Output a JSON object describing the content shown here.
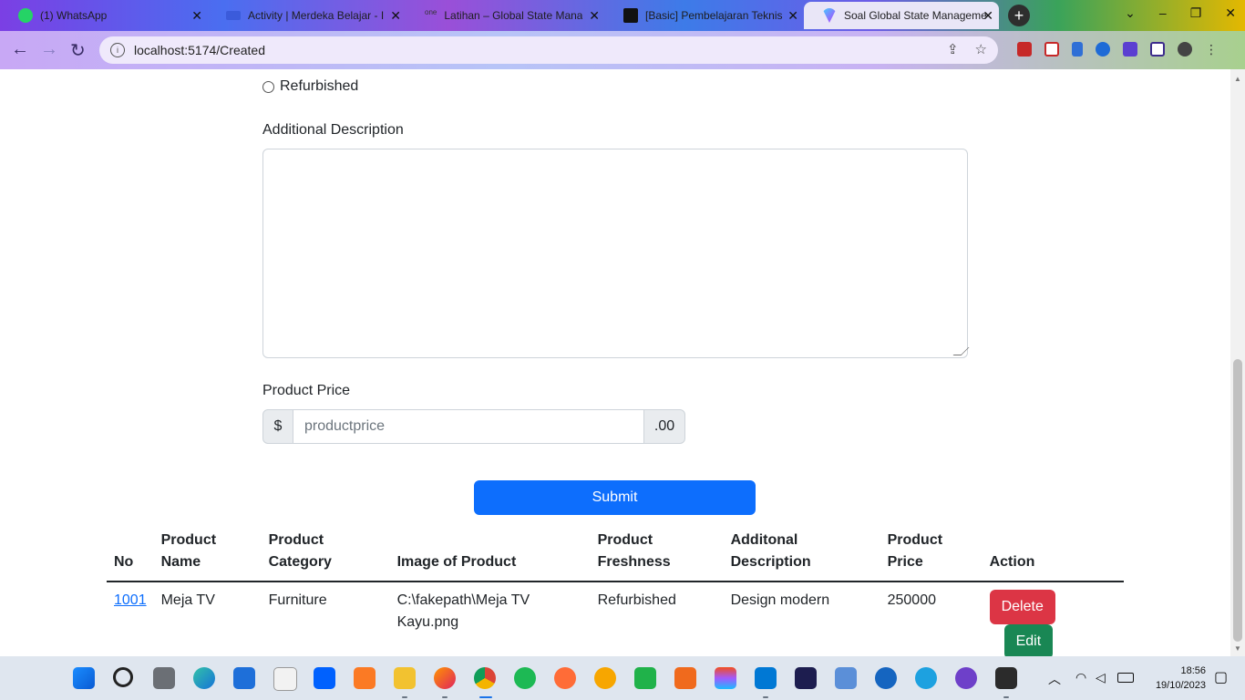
{
  "browser": {
    "tabs": [
      {
        "label": "(1) WhatsApp",
        "icon": "whatsapp-icon",
        "color": "#25d366"
      },
      {
        "label": "Activity | Merdeka Belajar - I",
        "icon": "kampus-merdeka-icon",
        "color": "#3b5bdb"
      },
      {
        "label": "Latihan – Global State Mana",
        "icon": "one-icon",
        "color": "#333333"
      },
      {
        "label": "[Basic] Pembelajaran Teknis",
        "icon": "notion-icon",
        "color": "#111111"
      },
      {
        "label": "Soal Global State Manageme",
        "icon": "vite-icon",
        "color": "#a855f7"
      }
    ],
    "url": "localhost:5174/Created"
  },
  "form": {
    "radio_refurbished": "Refurbished",
    "additional_description_label": "Additional Description",
    "product_price_label": "Product Price",
    "price_prefix": "$",
    "price_placeholder": "productprice",
    "price_suffix": ".00",
    "submit_label": "Submit"
  },
  "table": {
    "headers": {
      "no": "No",
      "name_1": "Product",
      "name_2": "Name",
      "category_1": "Product",
      "category_2": "Category",
      "image": "Image of Product",
      "freshness_1": "Product",
      "freshness_2": "Freshness",
      "desc_1": "Additonal",
      "desc_2": "Description",
      "price_1": "Product",
      "price_2": "Price",
      "action": "Action"
    },
    "rows": [
      {
        "no": "1001",
        "name": "Meja TV",
        "category": "Furniture",
        "image_1": "C:\\fakepath\\Meja TV",
        "image_2": "Kayu.png",
        "freshness": "Refurbished",
        "description": "Design modern",
        "price": "250000",
        "delete_label": "Delete",
        "edit_label": "Edit"
      }
    ]
  },
  "taskbar": {
    "time": "18:56",
    "date": "19/10/2023"
  }
}
